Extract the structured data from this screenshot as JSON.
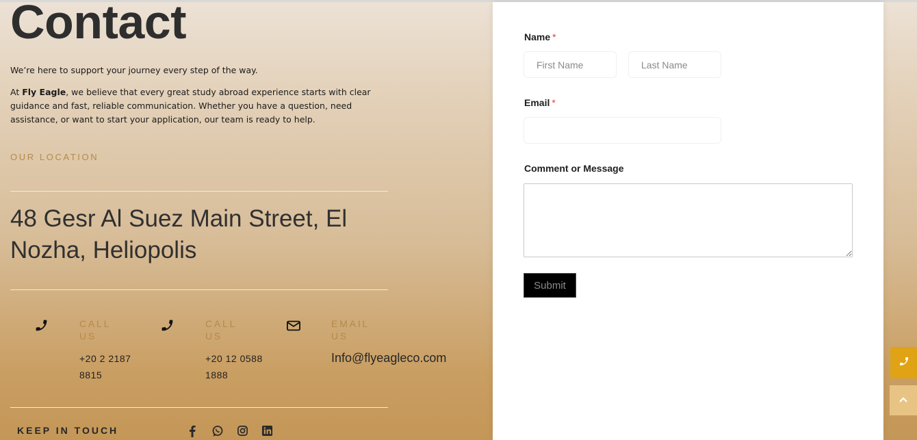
{
  "hero": {
    "title": "Contact",
    "intro": "We’re here to support your journey every step of the way.",
    "desc_prefix": "At ",
    "desc_brand": "Fly Eagle",
    "desc_rest": ", we believe that every great study abroad experience starts with clear guidance and fast, reliable communication. Whether you have a question, need assistance, or want to start your application, our team is ready to help."
  },
  "location": {
    "label": "OUR LOCATION",
    "address": "48 Gesr Al Suez Main Street, El Nozha, Heliopolis"
  },
  "contacts": [
    {
      "icon": "phone-icon",
      "label": "CALL US",
      "value": "+20 2 2187 8815"
    },
    {
      "icon": "phone-icon",
      "label": "CALL US",
      "value": "+20 12 0588 1888"
    },
    {
      "icon": "envelope-icon",
      "label": "EMAIL US",
      "value": "Info@flyeagleco.com"
    }
  ],
  "social": {
    "heading": "KEEP IN TOUCH",
    "icons": [
      "facebook-icon",
      "whatsapp-icon",
      "instagram-icon",
      "linkedin-icon"
    ]
  },
  "form": {
    "name_label": "Name",
    "required_mark": "*",
    "first_name_placeholder": "First Name",
    "last_name_placeholder": "Last Name",
    "email_label": "Email",
    "email_value": "",
    "message_label": "Comment or Message",
    "message_value": "",
    "submit_label": "Submit"
  },
  "colors": {
    "accent_gold": "#b58a47",
    "float_call_bg": "#e0a315",
    "float_top_bg": "#e8c484",
    "required": "#d9433a"
  },
  "floating": {
    "call_icon": "phone-icon",
    "top_icon": "chevron-up-icon"
  }
}
